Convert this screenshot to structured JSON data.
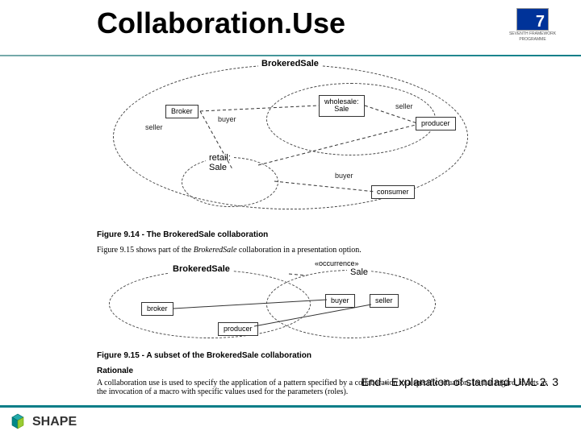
{
  "slide": {
    "title": "Collaboration.Use",
    "end_note": "End - Explanation of standard UML 2. 3"
  },
  "fp7": {
    "caption_line1": "SEVENTH FRAMEWORK",
    "caption_line2": "PROGRAMME"
  },
  "shape_logo": {
    "text": "SHAPE"
  },
  "diagram1": {
    "collab_name": "BrokeredSale",
    "use1_name": "wholesale:\nSale",
    "use2_name": "retail:\nSale",
    "parts": {
      "broker": "Broker",
      "producer": "producer",
      "consumer": "consumer"
    },
    "roles": {
      "seller": "seller",
      "buyer": "buyer",
      "seller2": "seller",
      "buyer2": "buyer"
    },
    "caption": "Figure 9.14 - The BrokeredSale collaboration"
  },
  "para1": {
    "pre": "Figure 9.15 shows part of the ",
    "em": "BrokeredSale",
    "post": " collaboration in a presentation option."
  },
  "diagram2": {
    "collab_name": "BrokeredSale",
    "stereotype": "«occurrence»",
    "use_name": "Sale",
    "parts": {
      "broker": "broker",
      "producer": "producer",
      "buyer": "buyer",
      "seller": "seller"
    },
    "caption": "Figure 9.15 - A subset of the BrokeredSale collaboration"
  },
  "rationale": {
    "heading": "Rationale",
    "text": "A collaboration use is used to specify the application of a pattern specified by a collaboration to a specific situation. In that regard, it acts as the invocation of a macro with specific values used for the parameters (roles)."
  }
}
